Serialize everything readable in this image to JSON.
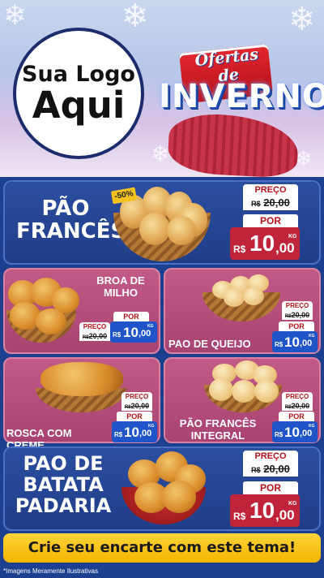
{
  "header": {
    "logo_line1": "Sua Logo",
    "logo_line2": "Aqui",
    "brand_sub": "Ofertas de",
    "brand_main": "INVERNO"
  },
  "labels": {
    "preco": "PREÇO",
    "por": "POR",
    "currency": "R$",
    "unit": "KG"
  },
  "products": [
    {
      "name": "PÃO FRANCÊS",
      "old": "20,00",
      "new_int": "10",
      "new_dec": ",00",
      "badge": "-50%"
    },
    {
      "name": "BROA DE MILHO",
      "old": "20,00",
      "new_int": "10",
      "new_dec": ",00"
    },
    {
      "name": "PAO DE QUEIJO",
      "old": "20,00",
      "new_int": "10",
      "new_dec": ",00"
    },
    {
      "name": "ROSCA COM CREME",
      "old": "20,00",
      "new_int": "10",
      "new_dec": ",00"
    },
    {
      "name": "PÃO FRANCÊS INTEGRAL",
      "old": "20,00",
      "new_int": "10",
      "new_dec": ",00"
    },
    {
      "name": "PAO DE BATATA PADARIA",
      "old": "20,00",
      "new_int": "10",
      "new_dec": ",00"
    }
  ],
  "footer": {
    "cta": "Crie seu encarte com este tema!",
    "disclaimer": "*Imagens Meramente Ilustrativas"
  },
  "colors": {
    "background": "#1c3f8f",
    "blue_panel": "#2c4ea0",
    "pink_panel": "#c25a86",
    "price_red": "#c0243a",
    "price_blue": "#1f55c9",
    "cta_yellow": "#f4b400"
  }
}
